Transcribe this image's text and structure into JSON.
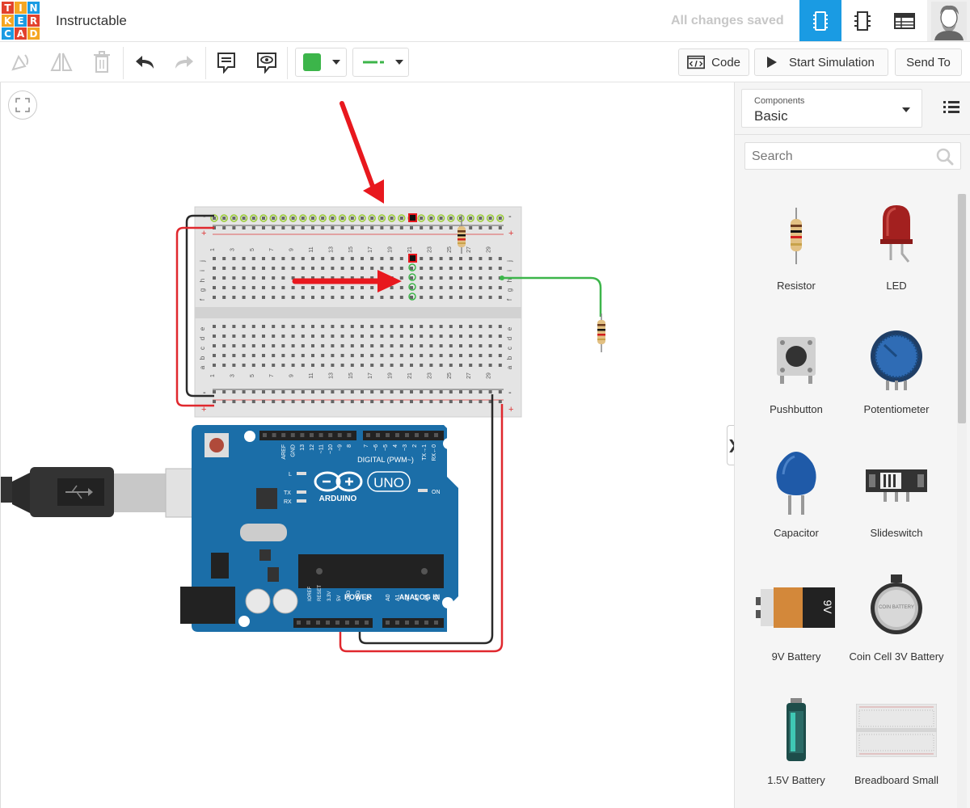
{
  "header": {
    "logo_letters": [
      "T",
      "I",
      "N",
      "K",
      "E",
      "R",
      "C",
      "A",
      "D"
    ],
    "logo_colors": [
      "#e2412c",
      "#f5a623",
      "#1a9be3",
      "#f5a623",
      "#1a9be3",
      "#e2412c",
      "#1a9be3",
      "#e2412c",
      "#f5a623"
    ],
    "project_title": "Instructable",
    "save_status": "All changes saved",
    "active_view": "circuit"
  },
  "toolbar": {
    "code_label": "Code",
    "simulate_label": "Start Simulation",
    "send_label": "Send To",
    "wire_color": "#3cb54a"
  },
  "panel": {
    "components_label": "Components",
    "components_value": "Basic",
    "search_placeholder": "Search",
    "items": [
      {
        "label": "Resistor"
      },
      {
        "label": "LED"
      },
      {
        "label": "Pushbutton"
      },
      {
        "label": "Potentiometer"
      },
      {
        "label": "Capacitor"
      },
      {
        "label": "Slideswitch"
      },
      {
        "label": "9V Battery"
      },
      {
        "label": "Coin Cell 3V Battery"
      },
      {
        "label": "1.5V Battery"
      },
      {
        "label": "Breadboard Small"
      }
    ]
  },
  "breadboard": {
    "columns_top": [
      "1",
      "",
      "3",
      "",
      "5",
      "",
      "7",
      "",
      "9",
      "",
      "11",
      "",
      "13",
      "",
      "15",
      "",
      "17",
      "",
      "19",
      "",
      "21",
      "",
      "23",
      "",
      "25",
      "",
      "27",
      "",
      "29",
      ""
    ],
    "columns_bottom": [
      "1",
      "",
      "3",
      "",
      "5",
      "",
      "7",
      "",
      "9",
      "",
      "11",
      "",
      "13",
      "",
      "15",
      "",
      "17",
      "",
      "19",
      "",
      "21",
      "",
      "23",
      "",
      "25",
      "",
      "27",
      "",
      "29",
      ""
    ],
    "rows_top": [
      "j",
      "i",
      "h",
      "g",
      "f"
    ],
    "rows_bottom": [
      "e",
      "d",
      "c",
      "b",
      "a"
    ],
    "rail_minus": "-",
    "rail_plus": "+"
  },
  "arduino": {
    "brand": "ARDUINO",
    "model": "UNO",
    "digital_label": "DIGITAL (PWM~)",
    "power_label": "POWER",
    "analog_label": "ANALOG IN",
    "on_label": "ON",
    "tx_label": "TX",
    "rx_label": "RX",
    "l_label": "L",
    "digital_pins": [
      "AREF",
      "GND",
      "13",
      "12",
      "~11",
      "~10",
      "~9",
      "8",
      "7",
      "~6",
      "~5",
      "4",
      "~3",
      "2",
      "TX→1",
      "RX←0"
    ],
    "power_pins": [
      "IOREF",
      "RESET",
      "3.3V",
      "5V",
      "GND",
      "GND",
      "Vin"
    ],
    "analog_pins": [
      "A0",
      "A1",
      "A2",
      "A3",
      "A4",
      "A5"
    ]
  },
  "battery_label": "9V",
  "coin_label": "COIN BATTERY",
  "colors": {
    "accent": "#1a9be3",
    "wire_red": "#e0282e",
    "wire_black": "#2a2a2a",
    "wire_green": "#3cb54a",
    "annotation_red": "#e8181e",
    "arduino_blue": "#1b6ea8"
  }
}
